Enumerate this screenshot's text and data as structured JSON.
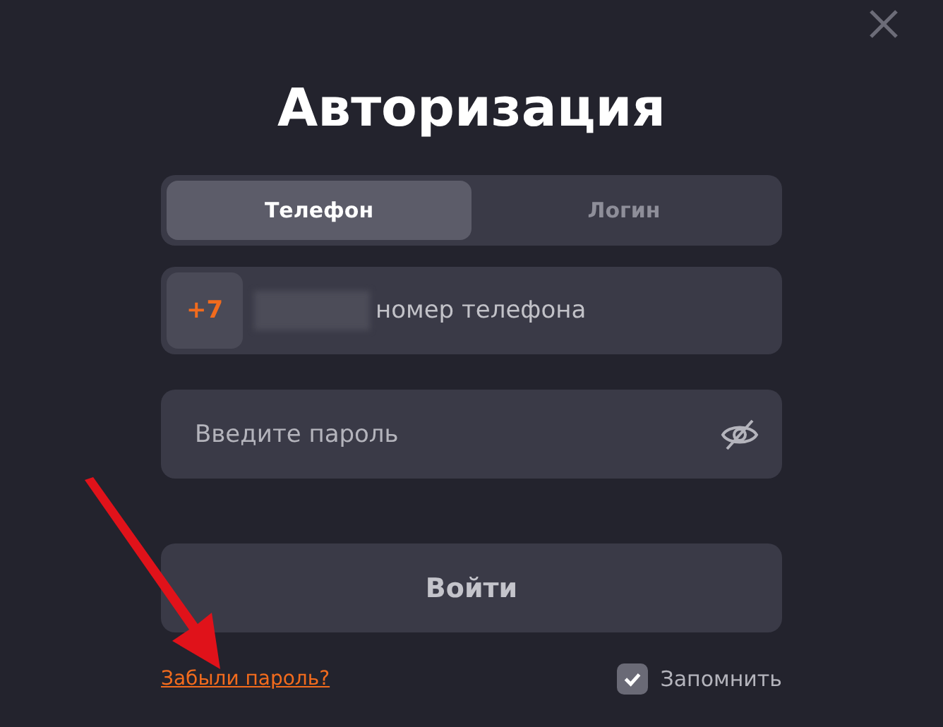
{
  "title": "Авторизация",
  "tabs": [
    {
      "label": "Телефон",
      "selected": true
    },
    {
      "label": "Логин",
      "selected": false
    }
  ],
  "phone": {
    "prefix": "+7",
    "placeholder": "номер телефона"
  },
  "password": {
    "placeholder": "Введите пароль"
  },
  "submit": "Войти",
  "forgot_link": "Забыли пароль?",
  "remember": {
    "label": "Запомнить",
    "checked": true
  }
}
